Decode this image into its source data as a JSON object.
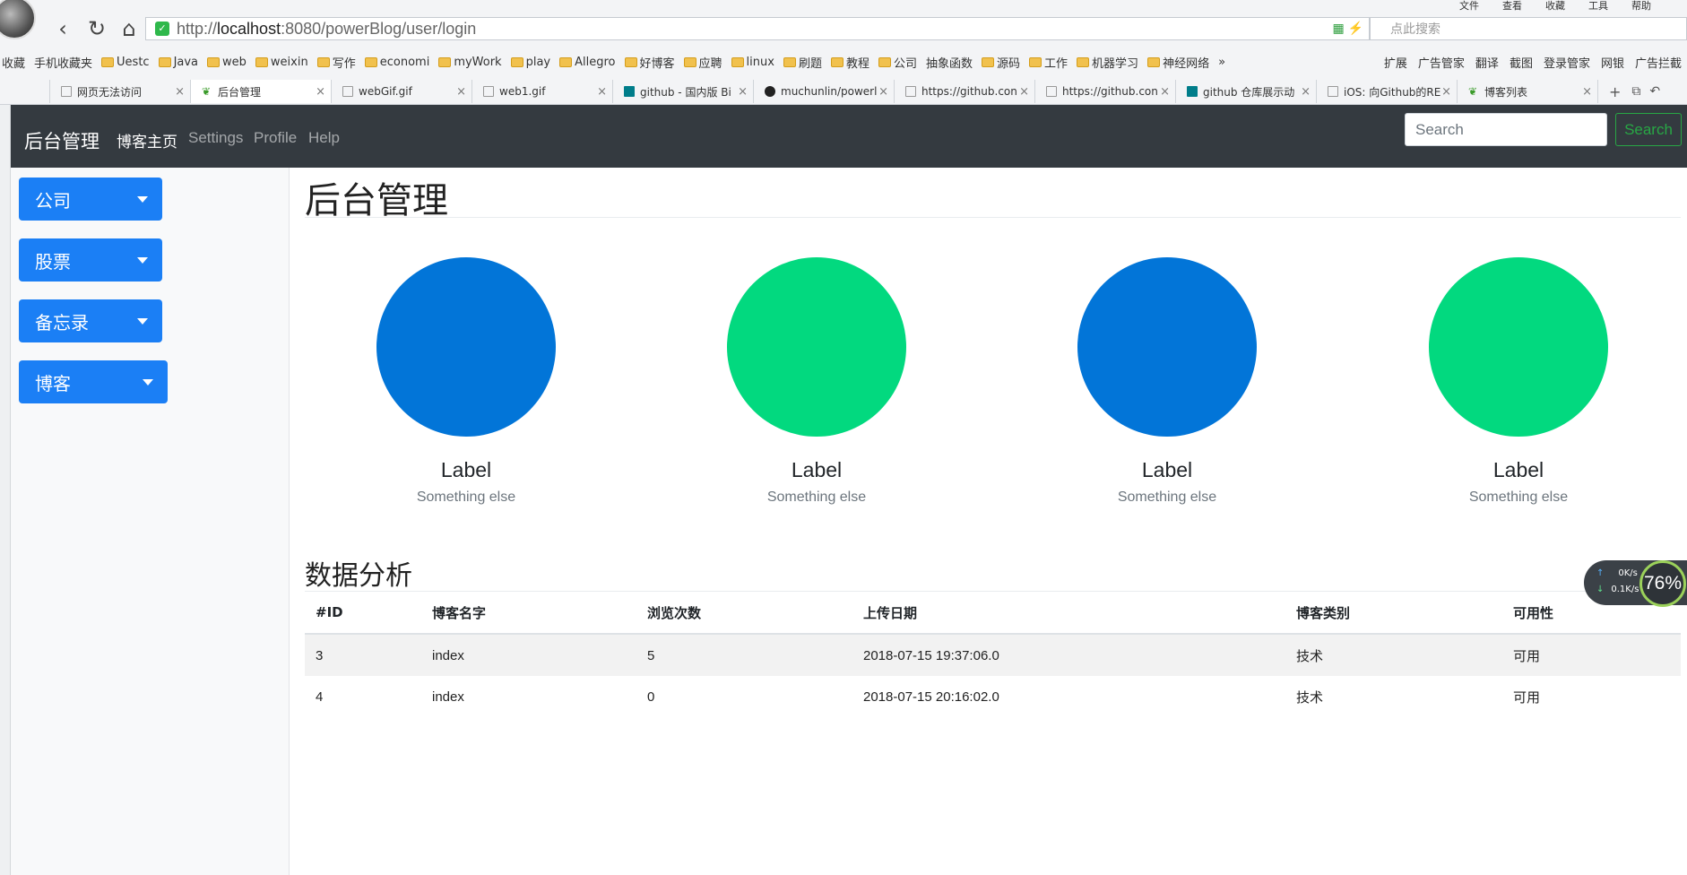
{
  "browser": {
    "menu": [
      "文件",
      "查看",
      "收藏",
      "工具",
      "帮助"
    ],
    "url_scheme": "http://",
    "url_host": "localhost",
    "url_rest": ":8080/powerBlog/user/login",
    "search_placeholder": "点此搜索",
    "bookmarks": [
      "收藏",
      "手机收藏夹",
      "Uestc",
      "Java",
      "web",
      "weixin",
      "写作",
      "economi",
      "myWork",
      "play",
      "Allegro",
      "好博客",
      "应聘",
      "linux",
      "刷题",
      "教程",
      "公司",
      "抽象函数",
      "源码",
      "工作",
      "机器学习",
      "神经网络"
    ],
    "bookmarks_more": "»",
    "bookmark_tools": [
      "扩展",
      "广告管家",
      "翻译",
      "截图",
      "登录管家",
      "网银",
      "广告拦截"
    ],
    "tabs": [
      {
        "label": "网页无法访问",
        "icon": "page"
      },
      {
        "label": "后台管理",
        "icon": "leaf",
        "active": true
      },
      {
        "label": "webGif.gif",
        "icon": "page"
      },
      {
        "label": "web1.gif",
        "icon": "page"
      },
      {
        "label": "github - 国内版 Bi",
        "icon": "bing"
      },
      {
        "label": "muchunlin/powerl",
        "icon": "github"
      },
      {
        "label": "https://github.con",
        "icon": "page"
      },
      {
        "label": "https://github.con",
        "icon": "page"
      },
      {
        "label": "github 仓库展示动",
        "icon": "bing"
      },
      {
        "label": "iOS: 向Github的RE",
        "icon": "page"
      },
      {
        "label": "博客列表",
        "icon": "leaf"
      }
    ]
  },
  "navbar": {
    "brand": "后台管理",
    "links": [
      "博客主页",
      "Settings",
      "Profile",
      "Help"
    ],
    "search_placeholder": "Search",
    "search_button": "Search"
  },
  "sidebar": {
    "items": [
      "公司",
      "股票",
      "备忘录",
      "博客"
    ]
  },
  "main": {
    "title": "后台管理",
    "cards": [
      {
        "label": "Label",
        "sub": "Something else",
        "color": "#0275d8"
      },
      {
        "label": "Label",
        "sub": "Something else",
        "color": "#02d97f"
      },
      {
        "label": "Label",
        "sub": "Something else",
        "color": "#0275d8"
      },
      {
        "label": "Label",
        "sub": "Something else",
        "color": "#02d97f"
      }
    ],
    "section_title": "数据分析",
    "table": {
      "headers": [
        "#ID",
        "博客名字",
        "浏览次数",
        "上传日期",
        "博客类别",
        "可用性"
      ],
      "rows": [
        [
          "3",
          "index",
          "5",
          "2018-07-15 19:37:06.0",
          "技术",
          "可用"
        ],
        [
          "4",
          "index",
          "0",
          "2018-07-15 20:16:02.0",
          "技术",
          "可用"
        ]
      ]
    }
  },
  "net_widget": {
    "up": "0K/s",
    "down": "0.1K/s",
    "percent": "76%"
  }
}
